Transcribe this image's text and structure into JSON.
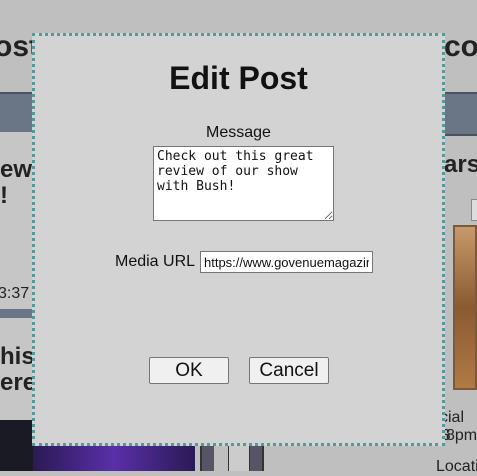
{
  "background": {
    "title_left": "ost",
    "title_right": "co",
    "left_heading_1": "ew\n!",
    "left_time": "3:37",
    "left_heading_2": "his\nere",
    "right_heading": "ars",
    "right_text_1": "cial S",
    "right_text_2": "8pm",
    "right_text_3": "Locati"
  },
  "modal": {
    "title": "Edit Post",
    "message_label": "Message",
    "message_value": "Check out this great review of our show with Bush!",
    "media_url_label": "Media URL",
    "media_url_value": "https://www.govenuemagazine.com",
    "ok_label": "OK",
    "cancel_label": "Cancel"
  },
  "colors": {
    "modal_bg": "#d3d3d3",
    "modal_border": "#4f9a9a",
    "navbar": "#6a7585"
  }
}
